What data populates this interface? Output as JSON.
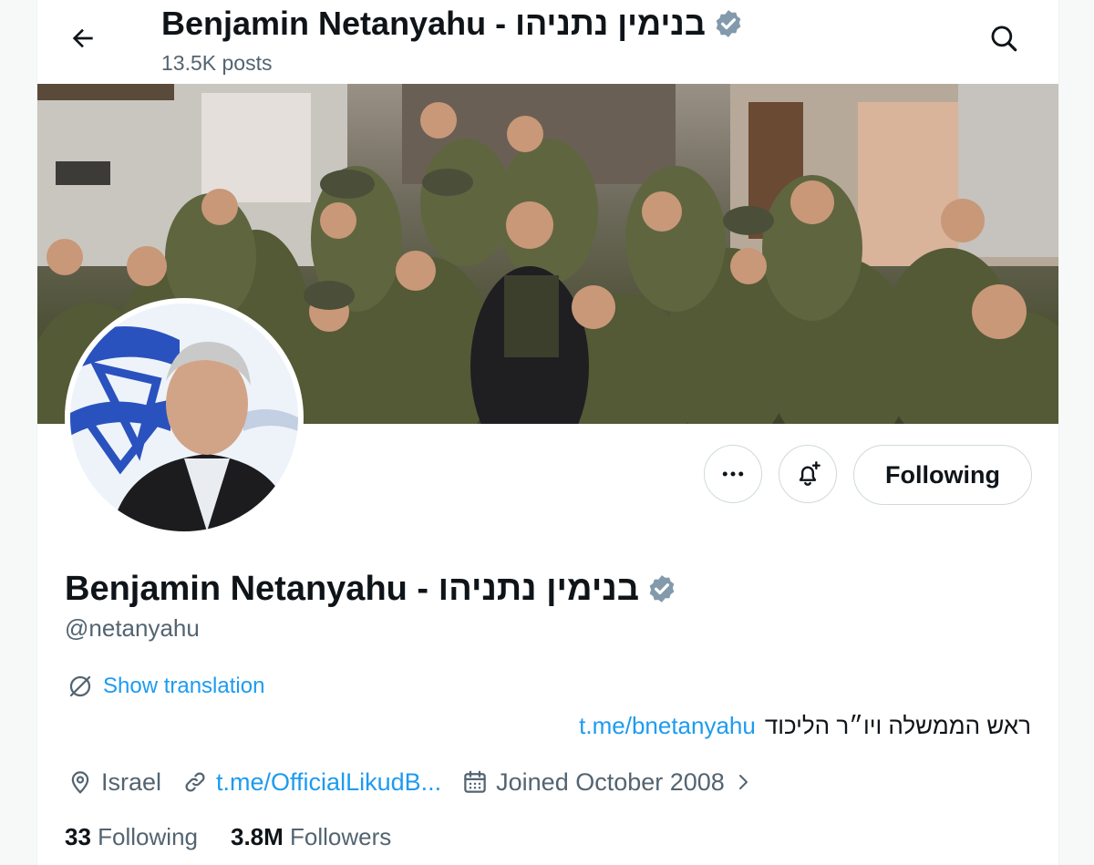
{
  "header": {
    "title": "Benjamin Netanyahu - בנימין נתניהו",
    "posts_count": "13.5K posts",
    "back_icon": "arrow-left-icon",
    "search_icon": "search-icon"
  },
  "profile": {
    "display_name": "Benjamin Netanyahu - בנימין נתניהו",
    "handle": "@netanyahu",
    "verified_icon": "verified-badge-icon",
    "show_translation": "Show translation",
    "bio_text": "ראש הממשלה ויו״ר הליכוד",
    "bio_link": "t.me/bnetanyahu",
    "location": "Israel",
    "website": "t.me/OfficialLikudB...",
    "joined": "Joined October 2008",
    "following_count": "33",
    "following_label": "Following",
    "followers_count": "3.8M",
    "followers_label": "Followers"
  },
  "actions": {
    "more_icon": "more-icon",
    "notify_icon": "bell-plus-icon",
    "following_button": "Following"
  },
  "colors": {
    "accent": "#1d9bf0",
    "secondary_text": "#536471",
    "verified": "#829aab",
    "border": "#cfd9de"
  }
}
